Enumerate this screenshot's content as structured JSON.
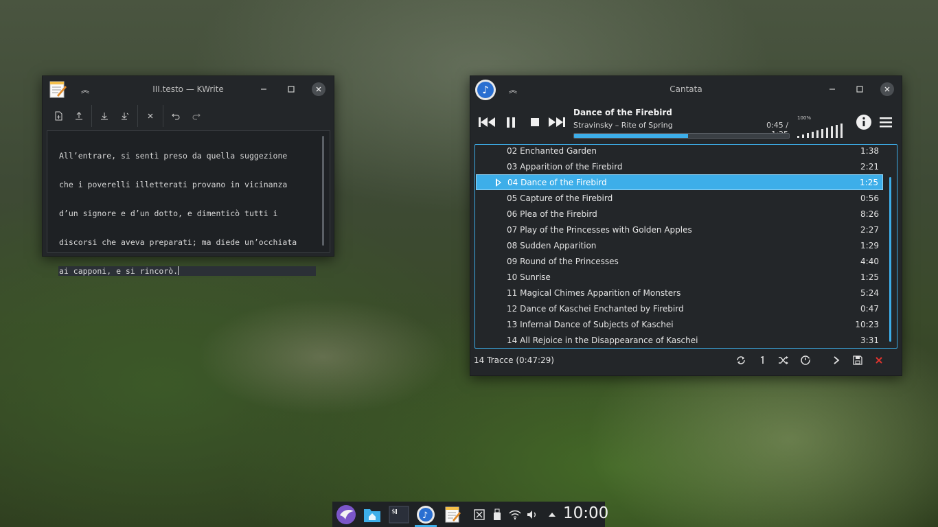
{
  "kwrite": {
    "title": "III.testo — KWrite",
    "text_lines": [
      "All’entrare, si sentì preso da quella suggezione",
      "che i poverelli illetterati provano in vicinanza",
      "d’un signore e d’un dotto, e dimenticò tutti i",
      "discorsi che aveva preparati; ma diede un’occhiata",
      "ai capponi, e si rincorò."
    ],
    "toolbar_icons": [
      "new-document-icon",
      "open-document-icon",
      "save-icon",
      "save-as-icon",
      "close-document-icon",
      "undo-icon",
      "redo-icon"
    ]
  },
  "cantata": {
    "title": "Cantata",
    "now_playing": {
      "title": "Dance of the Firebird",
      "artist_album": "Stravinsky – Rite of Spring",
      "time": "0:45 / 1:25",
      "progress": 0.53
    },
    "volume": {
      "label": "100%",
      "level": 1.0
    },
    "tracks": [
      {
        "title": "02 Enchanted Garden",
        "duration": "1:38"
      },
      {
        "title": "03 Apparition of the Firebird",
        "duration": "2:21"
      },
      {
        "title": "04 Dance of the Firebird",
        "duration": "1:25",
        "playing": true
      },
      {
        "title": "05 Capture of the Firebird",
        "duration": "0:56"
      },
      {
        "title": "06 Plea of the Firebird",
        "duration": "8:26"
      },
      {
        "title": "07 Play of the Princesses with Golden Apples",
        "duration": "2:27"
      },
      {
        "title": "08 Sudden Apparition",
        "duration": "1:29"
      },
      {
        "title": "09 Round of the Princesses",
        "duration": "4:40"
      },
      {
        "title": "10 Sunrise",
        "duration": "1:25"
      },
      {
        "title": "11 Magical Chimes Apparition of Monsters",
        "duration": "5:24"
      },
      {
        "title": "12 Dance of Kaschei Enchanted by Firebird",
        "duration": "0:47"
      },
      {
        "title": "13 Infernal Dance of Subjects of Kaschei",
        "duration": "10:23"
      },
      {
        "title": "14 All Rejoice in the Disappearance of Kaschei",
        "duration": "3:31"
      }
    ],
    "status": "14 Tracce (0:47:29)",
    "accent": "#3daee9"
  },
  "taskbar": {
    "clock": "10:00",
    "items": [
      "launcher-icon",
      "file-manager-icon",
      "terminal-icon",
      "cantata-icon",
      "kwrite-icon"
    ],
    "tray": [
      "clipboard-icon",
      "usb-icon",
      "wifi-icon",
      "volume-icon",
      "tray-expand-icon"
    ]
  }
}
